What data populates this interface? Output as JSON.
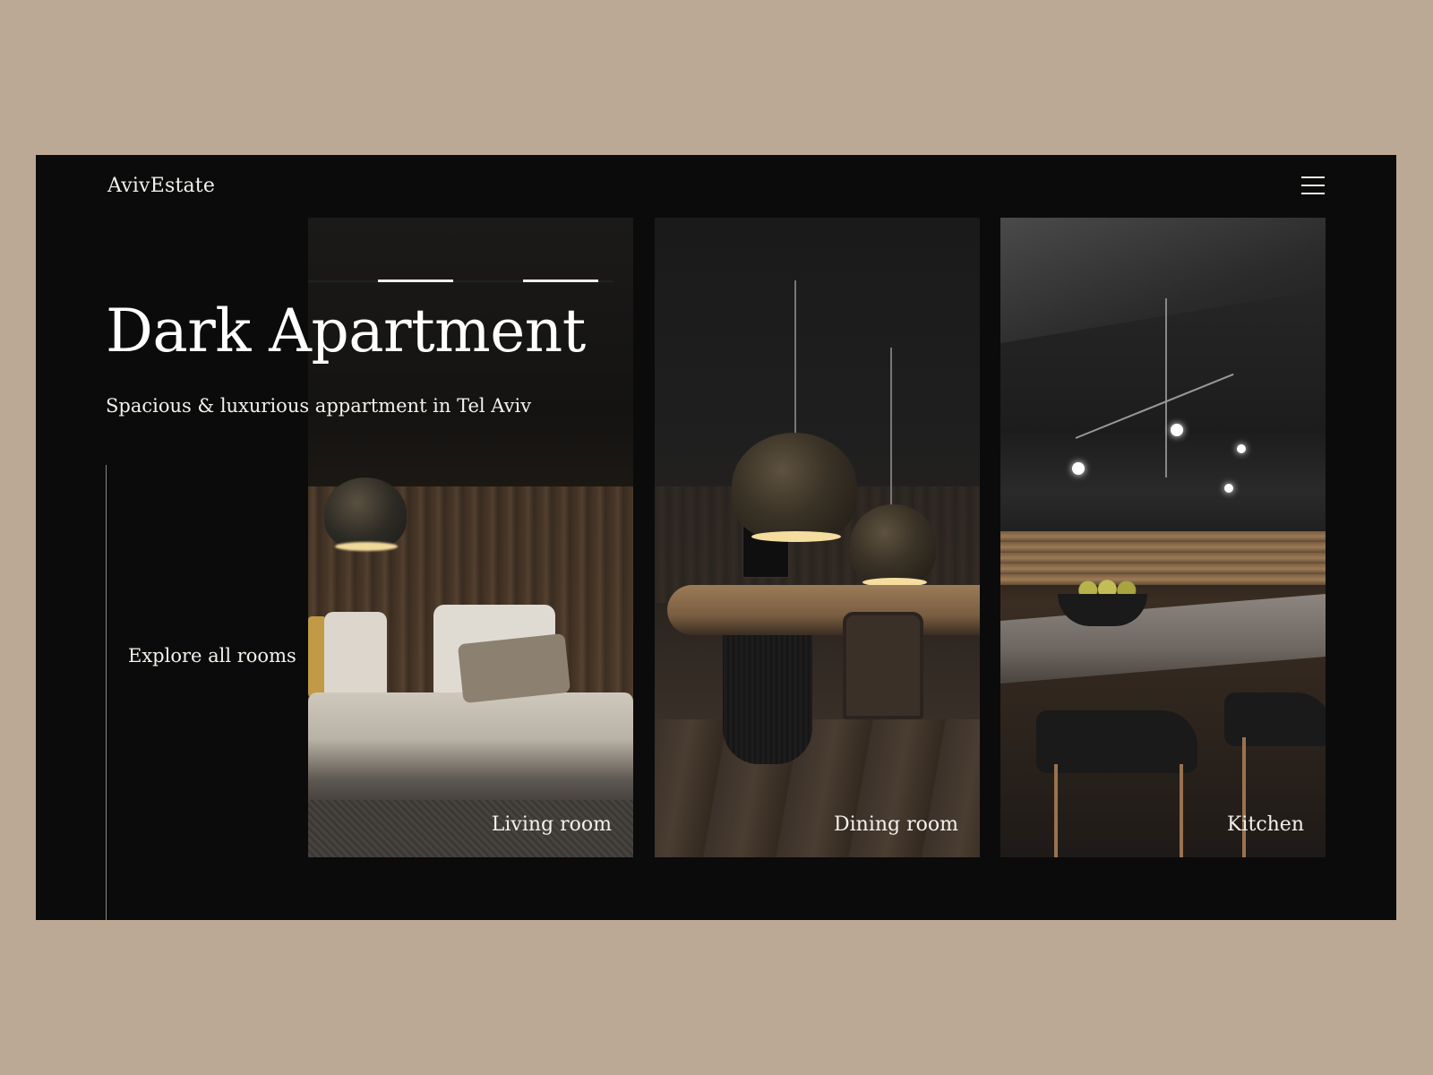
{
  "header": {
    "logo": "AvivEstate",
    "menu_icon": "hamburger-menu-icon"
  },
  "hero": {
    "title": "Dark Apartment",
    "subtitle": "Spacious & luxurious appartment in Tel Aviv"
  },
  "explore": {
    "label": "Explore all rooms"
  },
  "rooms": [
    {
      "label": "Living room"
    },
    {
      "label": "Dining room"
    },
    {
      "label": "Kitchen"
    }
  ],
  "colors": {
    "page_background": "#bba995",
    "frame_background": "#0b0b0b",
    "text": "#f3f1ec"
  }
}
